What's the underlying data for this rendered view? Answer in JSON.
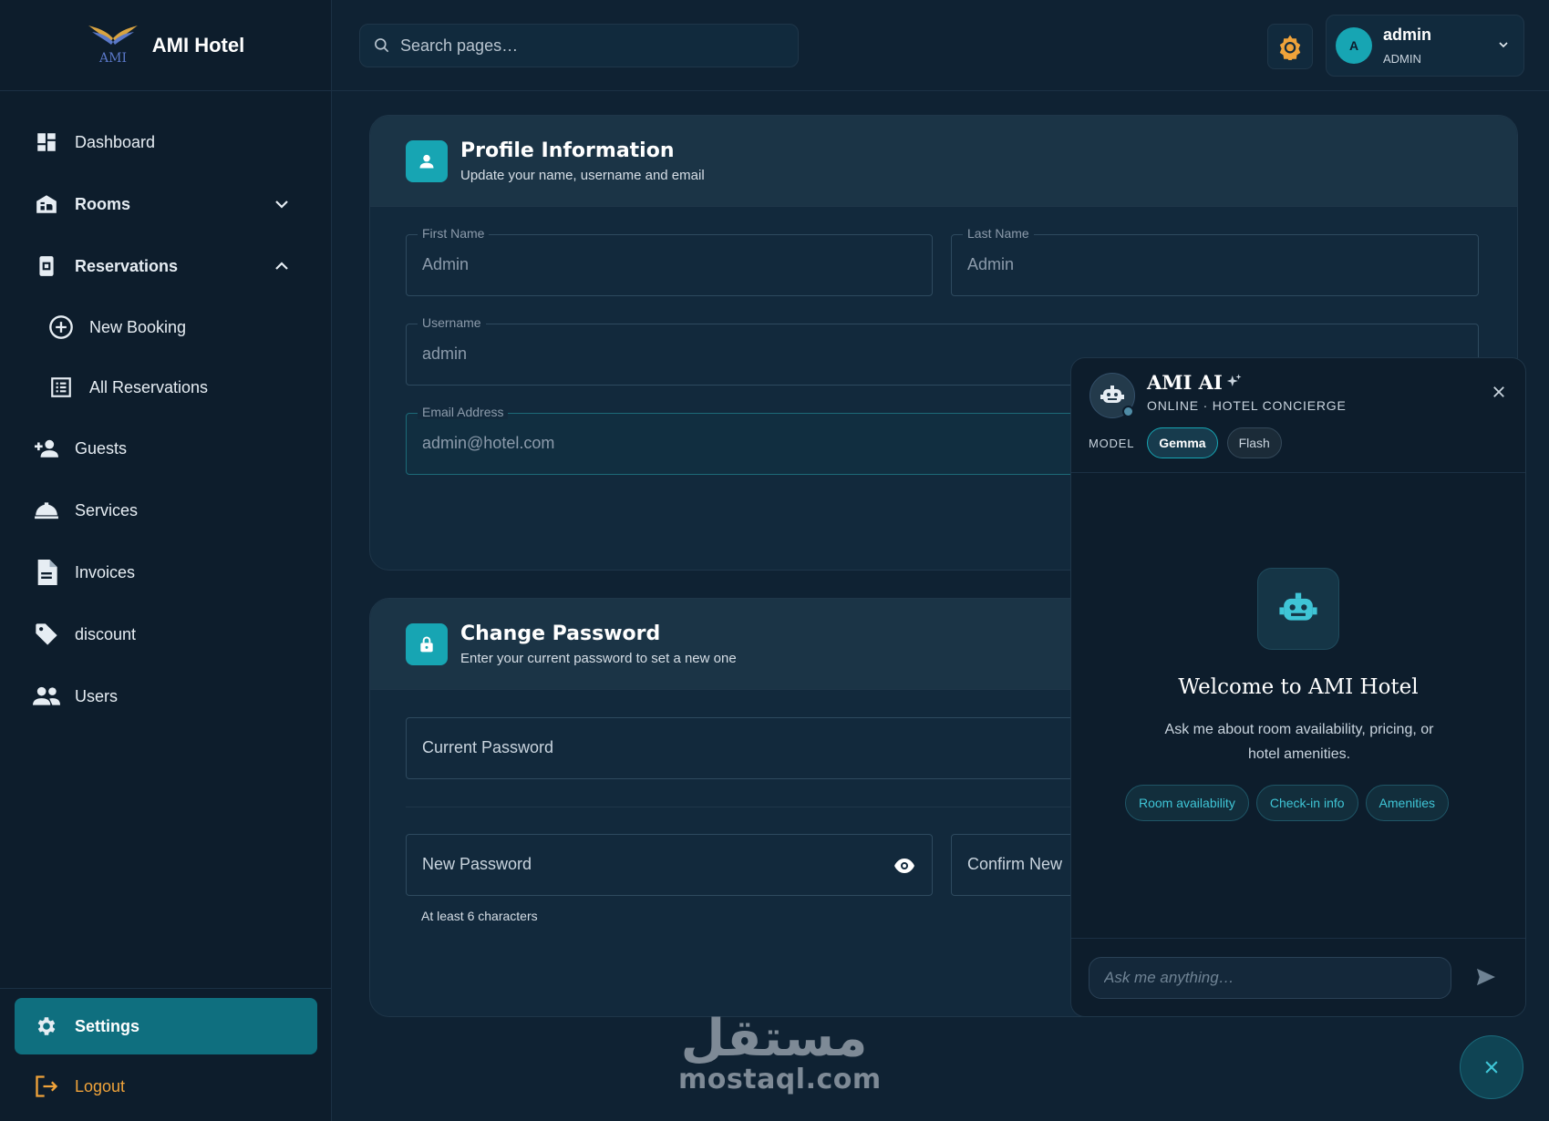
{
  "brand": {
    "name": "AMI Hotel",
    "logo_text": "AMI"
  },
  "sidebar": {
    "items": [
      {
        "label": "Dashboard",
        "icon": "dashboard-icon"
      },
      {
        "label": "Rooms",
        "icon": "hotel-icon"
      },
      {
        "label": "Reservations",
        "icon": "reservation-icon"
      },
      {
        "label": "New Booking",
        "icon": "add-circle-icon"
      },
      {
        "label": "All Reservations",
        "icon": "list-icon"
      },
      {
        "label": "Guests",
        "icon": "person-add-icon"
      },
      {
        "label": "Services",
        "icon": "room-service-icon"
      },
      {
        "label": "Invoices",
        "icon": "document-icon"
      },
      {
        "label": "discount",
        "icon": "tag-icon"
      },
      {
        "label": "Users",
        "icon": "people-icon"
      }
    ],
    "settings_label": "Settings",
    "logout_label": "Logout"
  },
  "topbar": {
    "search_placeholder": "Search pages…",
    "user_initial": "A",
    "user_name": "admin",
    "user_role": "ADMIN"
  },
  "profile": {
    "title": "Profile Information",
    "subtitle": "Update your name, username and email",
    "first_name_label": "First Name",
    "first_name_value": "Admin",
    "last_name_label": "Last Name",
    "last_name_value": "Admin",
    "username_label": "Username",
    "username_value": "admin",
    "email_label": "Email Address",
    "email_value": "admin@hotel.com"
  },
  "password": {
    "title": "Change Password",
    "subtitle": "Enter your current password to set a new one",
    "current_placeholder": "Current Password",
    "new_placeholder": "New Password",
    "confirm_placeholder": "Confirm New",
    "hint": "At least 6 characters"
  },
  "chat": {
    "title": "AMI AI",
    "status": "ONLINE · HOTEL CONCIERGE",
    "model_label": "MODEL",
    "models": [
      "Gemma",
      "Flash"
    ],
    "welcome": "Welcome to AMI Hotel",
    "welcome_sub": "Ask me about room availability, pricing, or hotel amenities.",
    "quick_actions": [
      "Room availability",
      "Check-in info",
      "Amenities"
    ],
    "input_placeholder": "Ask me anything…"
  },
  "watermark": {
    "arabic": "مستقل",
    "latin": "mostaql.com"
  },
  "colors": {
    "accent": "#17a5b3",
    "background": "#0f2233",
    "sidebar": "#0d1d2c",
    "active_nav": "#0f6f7f",
    "logout": "#f0a33a",
    "theme_icon": "#f0a33a"
  }
}
